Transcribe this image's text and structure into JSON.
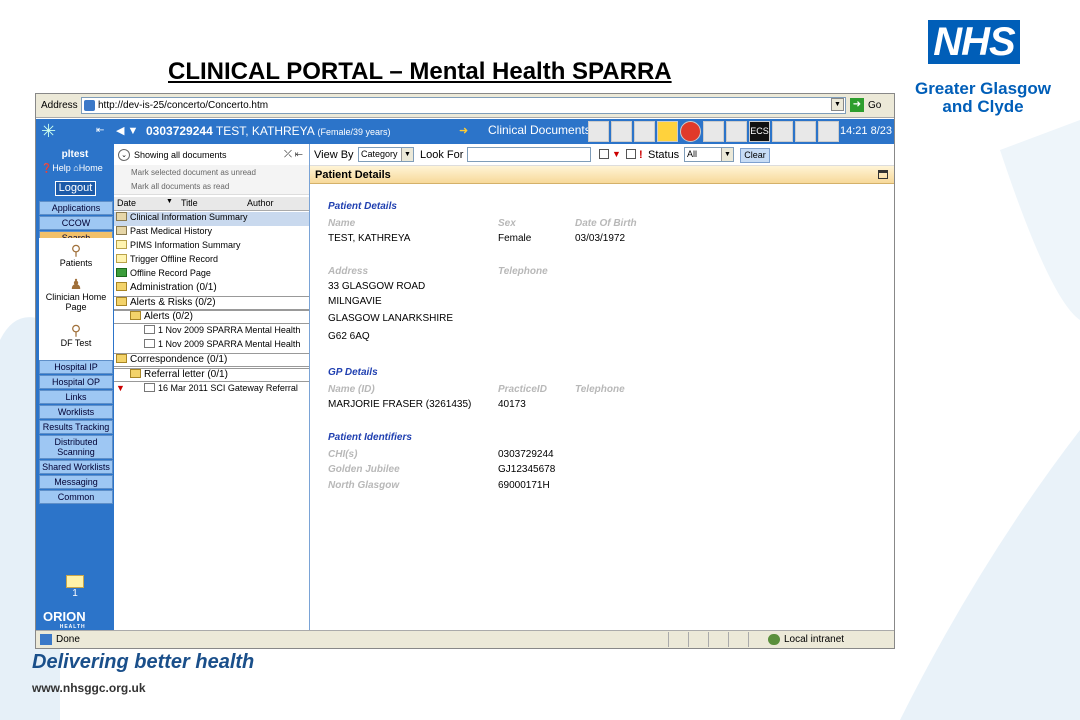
{
  "slide": {
    "title": "CLINICAL PORTAL – Mental Health SPARRA",
    "tagline": "Delivering better health",
    "website": "www.nhsggc.org.uk",
    "logo": {
      "main": "NHS",
      "line1": "Greater Glasgow",
      "line2": "and Clyde"
    }
  },
  "browser": {
    "address_label": "Address",
    "url": "http://dev-is-25/concerto/Concerto.htm",
    "go_label": "Go",
    "status_text": "Done",
    "zone_text": "Local intranet"
  },
  "app_header": {
    "patient_id": "0303729244",
    "patient_name": "TEST, KATHREYA",
    "patient_info": "(Female/39 years)",
    "section": "Clinical Documents",
    "ecs_label": "ECS",
    "time": "14:21 8/23"
  },
  "sidebar": {
    "user": "pltest",
    "help": "Help",
    "home": "Home",
    "logout": "Logout",
    "buttons": [
      "Applications",
      "CCOW",
      "Search"
    ],
    "search_items": [
      "Patients",
      "Clinician Home Page",
      "DF Test"
    ],
    "buttons2": [
      "Hospital IP",
      "Hospital OP",
      "Links",
      "Worklists",
      "Results Tracking",
      "Distributed Scanning",
      "Shared Worklists",
      "Messaging",
      "Common"
    ],
    "mail_count": "1",
    "brand": "ORION",
    "brand_sub": "HEALTH"
  },
  "doc_panel": {
    "showing": "Showing all documents",
    "mark_unread": "Mark selected document as unread",
    "mark_read": "Mark all documents as read",
    "columns": [
      "Date",
      "Title",
      "Author"
    ],
    "tree": [
      "Clinical Information Summary",
      "Past Medical History",
      "PIMS Information Summary",
      "Trigger Offline Record",
      "Offline Record Page",
      "Administration  (0/1)",
      "Alerts & Risks  (0/2)",
      "Alerts  (0/2)",
      "1 Nov 2009 SPARRA Mental Health",
      "1 Nov 2009 SPARRA Mental Health",
      "Correspondence  (0/1)",
      "Referral letter  (0/1)",
      "16 Mar 2011 SCI Gateway Referral"
    ]
  },
  "filter": {
    "view_by": "View By",
    "category": "Category",
    "look_for": "Look For",
    "look_for_value": "",
    "status_label": "Status",
    "status_value": "All",
    "clear": "Clear"
  },
  "details": {
    "header": "Patient Details",
    "patient_section": "Patient Details",
    "name_label": "Name",
    "sex_label": "Sex",
    "dob_label": "Date Of Birth",
    "name": "TEST, KATHREYA",
    "sex": "Female",
    "dob": "03/03/1972",
    "address_label": "Address",
    "telephone_label": "Telephone",
    "address": [
      "33 GLASGOW ROAD",
      "MILNGAVIE",
      "GLASGOW LANARKSHIRE",
      "G62 6AQ"
    ],
    "gp_section": "GP Details",
    "gp_name_label": "Name (ID)",
    "practice_label": "PracticeID",
    "gp_tel_label": "Telephone",
    "gp_name": "MARJORIE FRASER (3261435)",
    "practice_id": "40173",
    "ident_section": "Patient Identifiers",
    "chi_label": "CHI(s)",
    "chi": "0303729244",
    "gj_label": "Golden Jubilee",
    "gj": "GJ12345678",
    "ng_label": "North Glasgow",
    "ng": "69000171H"
  }
}
